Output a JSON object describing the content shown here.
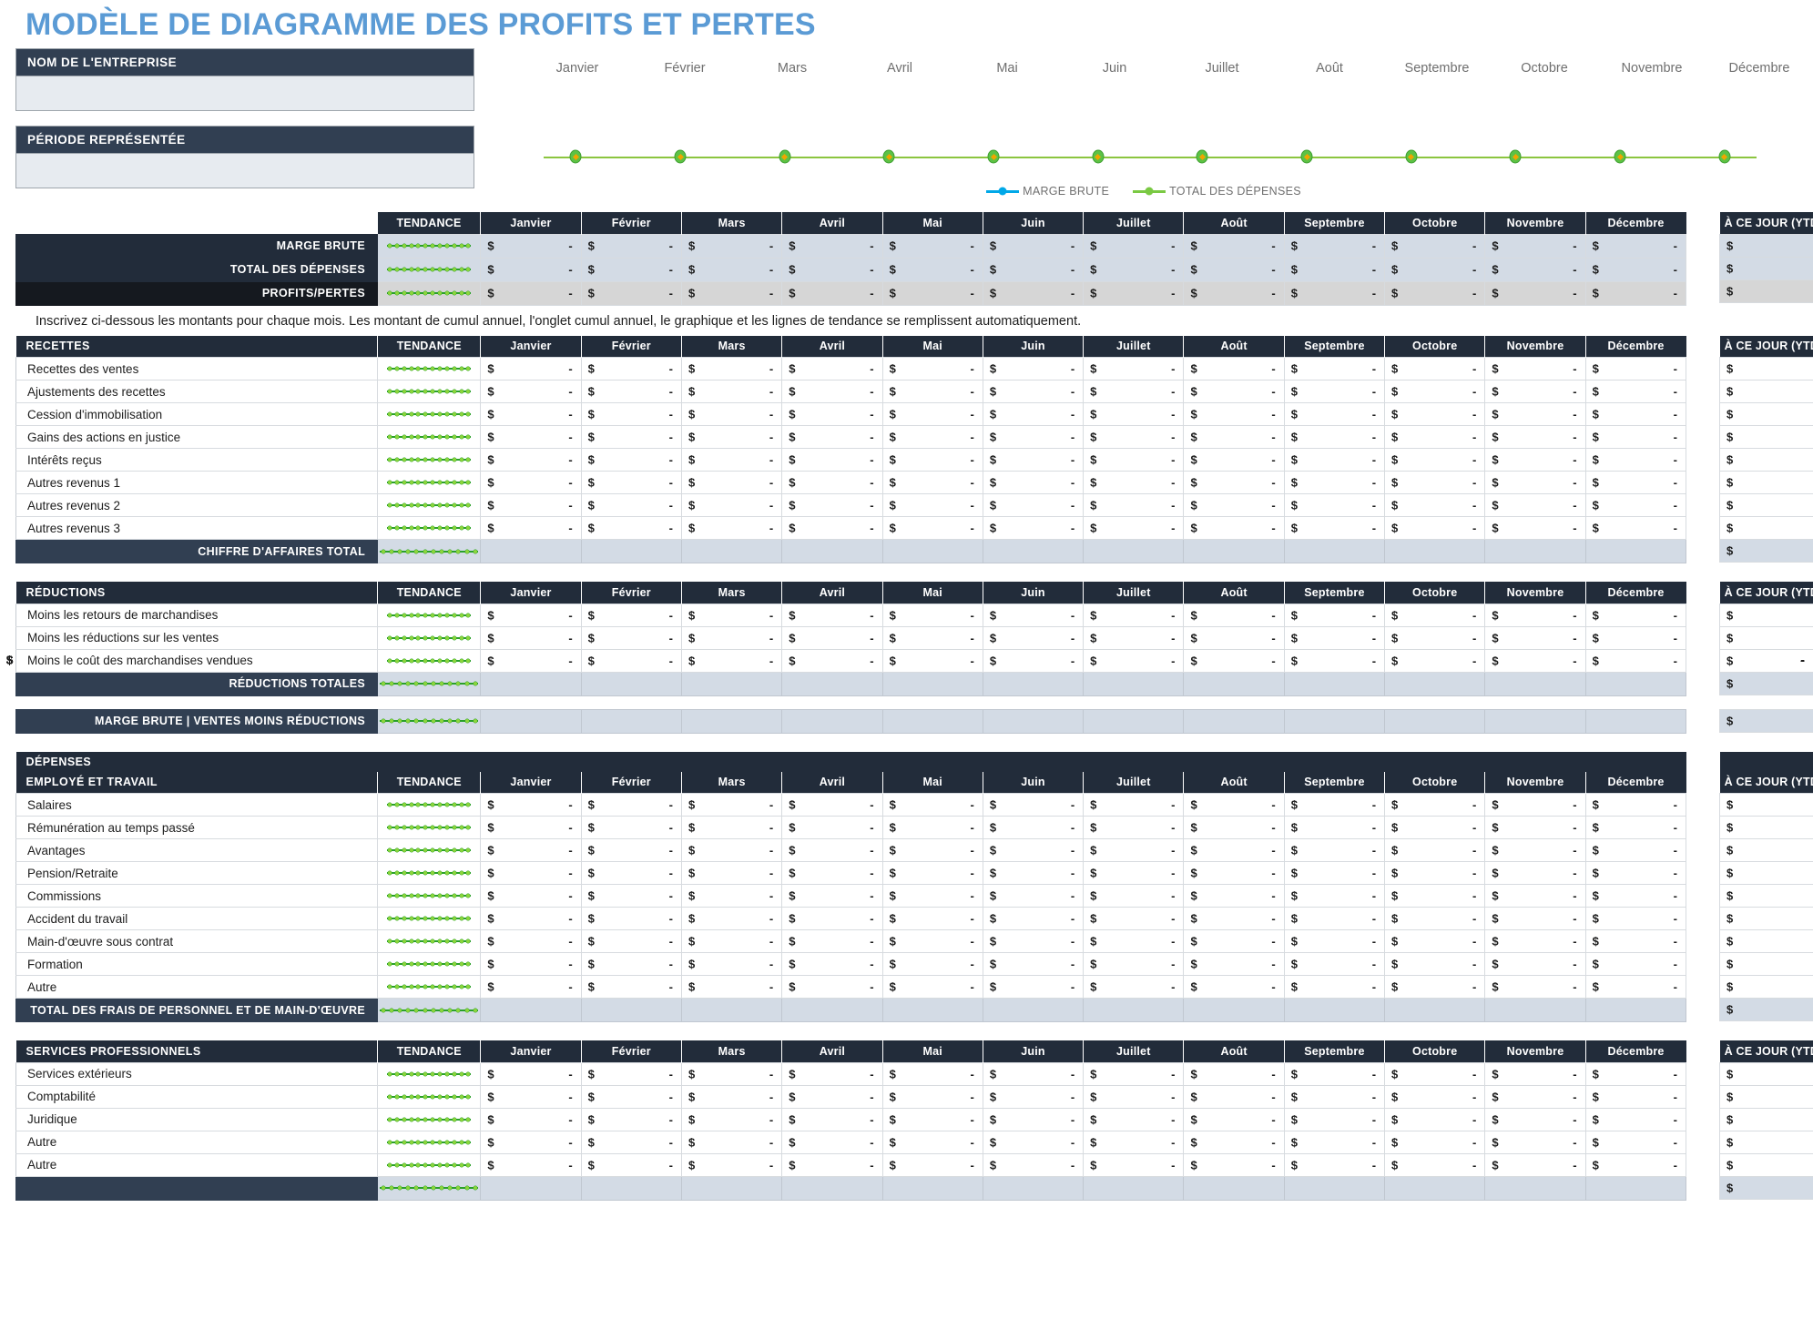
{
  "title": "MODÈLE DE DIAGRAMME DES PROFITS ET PERTES",
  "colors": {
    "title": "#5b9bd5",
    "header_dark": "#222c3a",
    "header_dark_alt": "#313f52",
    "marge_brute_legend": "#00a8e8",
    "depenses_legend": "#7ac943",
    "spark_green": "#2aa02a"
  },
  "info": {
    "company_label": "NOM DE L'ENTREPRISE",
    "company_value": "",
    "period_label": "PÉRIODE REPRÉSENTÉE",
    "period_value": ""
  },
  "chart": {
    "months": [
      "Janvier",
      "Février",
      "Mars",
      "Avril",
      "Mai",
      "Juin",
      "Juillet",
      "Août",
      "Septembre",
      "Octobre",
      "Novembre",
      "Décembre"
    ],
    "legend": [
      {
        "label": "MARGE BRUTE",
        "color": "#00a8e8"
      },
      {
        "label": "TOTAL DES DÉPENSES",
        "color": "#7ac943"
      }
    ]
  },
  "chart_data": {
    "type": "line",
    "title": "",
    "xlabel": "",
    "ylabel": "",
    "x": [
      "Janvier",
      "Février",
      "Mars",
      "Avril",
      "Mai",
      "Juin",
      "Juillet",
      "Août",
      "Septembre",
      "Octobre",
      "Novembre",
      "Décembre"
    ],
    "series": [
      {
        "name": "MARGE BRUTE",
        "color": "#00a8e8",
        "values": [
          0,
          0,
          0,
          0,
          0,
          0,
          0,
          0,
          0,
          0,
          0,
          0
        ]
      },
      {
        "name": "TOTAL DES DÉPENSES",
        "color": "#7ac943",
        "values": [
          0,
          0,
          0,
          0,
          0,
          0,
          0,
          0,
          0,
          0,
          0,
          0
        ]
      }
    ],
    "ylim": [
      0,
      0
    ],
    "grid": false,
    "legend_position": "bottom"
  },
  "columns": {
    "trend": "TENDANCE",
    "months": [
      "Janvier",
      "Février",
      "Mars",
      "Avril",
      "Mai",
      "Juin",
      "Juillet",
      "Août",
      "Septembre",
      "Octobre",
      "Novembre",
      "Décembre"
    ],
    "ytd": "À CE JOUR (YTD)"
  },
  "cell": {
    "currency": "$",
    "value": "-"
  },
  "summary": {
    "rows": [
      {
        "label": "MARGE BRUTE",
        "style": "dark"
      },
      {
        "label": "TOTAL DES DÉPENSES",
        "style": "dark"
      },
      {
        "label": "PROFITS/PERTES",
        "style": "darker"
      }
    ]
  },
  "note": "Inscrivez ci-dessous les montants pour chaque mois. Les montant de cumul annuel, l'onglet cumul annuel, le graphique et les lignes de tendance se remplissent automatiquement.",
  "sections": [
    {
      "key": "recettes",
      "header": "RECETTES",
      "rows": [
        "Recettes des ventes",
        "Ajustements des recettes",
        "Cession d'immobilisation",
        "Gains des actions en justice",
        "Intérêts reçus",
        "Autres revenus 1",
        "Autres revenus 2",
        "Autres revenus 3"
      ],
      "total": "CHIFFRE D'AFFAIRES TOTAL"
    },
    {
      "key": "reductions",
      "header": "RÉDUCTIONS",
      "rows": [
        "Moins les retours de marchandises",
        "Moins les réductions sur les ventes",
        "Moins le coût des marchandises vendues"
      ],
      "total": "RÉDUCTIONS TOTALES"
    },
    {
      "key": "marge_brute",
      "header": "",
      "rows": [],
      "total": "MARGE BRUTE  |  VENTES MOINS RÉDUCTIONS"
    },
    {
      "key": "employe",
      "band": "DÉPENSES",
      "header": "EMPLOYÉ ET TRAVAIL",
      "rows": [
        "Salaires",
        "Rémunération au temps passé",
        "Avantages",
        "Pension/Retraite",
        "Commissions",
        "Accident du travail",
        "Main-d'œuvre sous contrat",
        "Formation",
        "Autre"
      ],
      "total": "TOTAL DES FRAIS DE PERSONNEL ET DE MAIN-D'ŒUVRE"
    },
    {
      "key": "services",
      "header": "SERVICES PROFESSIONNELS",
      "rows": [
        "Services extérieurs",
        "Comptabilité",
        "Juridique",
        "Autre",
        "Autre"
      ],
      "total": ""
    }
  ]
}
